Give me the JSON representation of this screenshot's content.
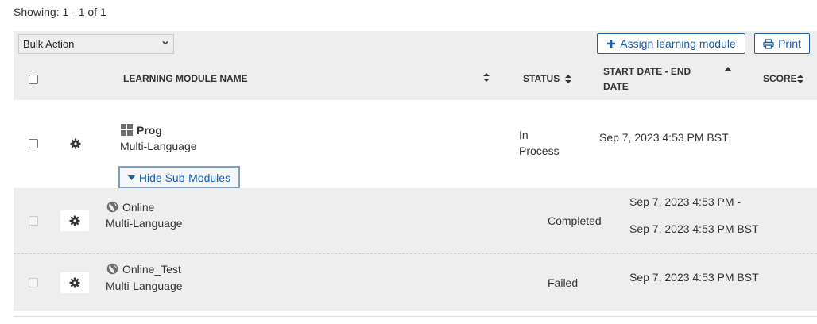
{
  "showing": "Showing: 1 - 1 of 1",
  "toolbar": {
    "bulk_action": "Bulk Action",
    "assign_label": "Assign learning module",
    "print_label": "Print"
  },
  "columns": {
    "name": "LEARNING MODULE NAME",
    "status": "STATUS",
    "dates": "START DATE - END DATE",
    "score": "SCORE"
  },
  "main_row": {
    "name": "Prog",
    "language": "Multi-Language",
    "status": "In Process",
    "dates": "Sep 7, 2023 4:53 PM BST",
    "toggle_label": "Hide Sub-Modules"
  },
  "sub_rows": [
    {
      "name": "Online",
      "language": "Multi-Language",
      "status": "Completed",
      "start": "Sep 7, 2023 4:53 PM -",
      "end": "Sep 7, 2023 4:53 PM BST"
    },
    {
      "name": "Online_Test",
      "language": "Multi-Language",
      "status": "Failed",
      "start": "Sep 7, 2023 4:53 PM BST"
    }
  ],
  "colors": {
    "link": "#1a5fa8",
    "band": "#eeeeee"
  }
}
